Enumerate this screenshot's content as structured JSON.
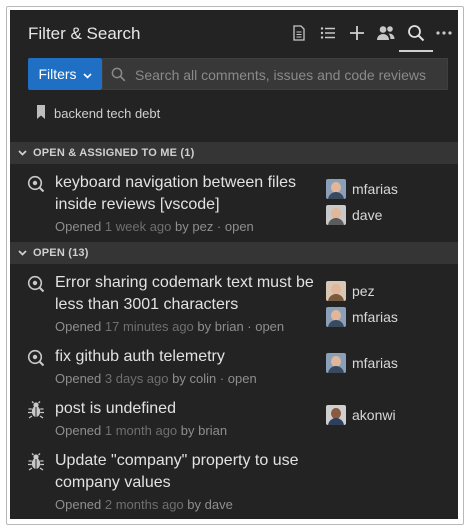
{
  "header": {
    "title": "Filter & Search",
    "tools": [
      "document-icon",
      "list-icon",
      "plus-icon",
      "people-icon",
      "search-icon",
      "more-icon"
    ]
  },
  "search": {
    "filters_label": "Filters",
    "placeholder": "Search all comments, issues and code reviews",
    "value": ""
  },
  "saved_filter": {
    "label": "backend tech debt",
    "icon": "bookmark-icon"
  },
  "sections": [
    {
      "label": "OPEN & ASSIGNED TO ME (1)",
      "items": [
        {
          "icon": "review-icon",
          "title_lines": [
            "keyboard navigation between files",
            "inside reviews [vscode]"
          ],
          "status_word": "Opened",
          "age": "1 week ago",
          "by": "by pez · open",
          "assignees": [
            "mfarias",
            "dave"
          ]
        }
      ]
    },
    {
      "label": "OPEN (13)",
      "items": [
        {
          "icon": "review-icon",
          "title_lines": [
            "Error sharing codemark text must be",
            "less than 3001 characters"
          ],
          "status_word": "Opened",
          "age": "17 minutes ago",
          "by": "by brian · open",
          "assignees": [
            "pez",
            "mfarias"
          ]
        },
        {
          "icon": "review-icon",
          "title_lines": [
            "fix github auth telemetry"
          ],
          "status_word": "Opened",
          "age": "3 days ago",
          "by": "by colin · open",
          "assignees": [
            "mfarias"
          ]
        },
        {
          "icon": "bug-icon",
          "title_lines": [
            "post is undefined"
          ],
          "status_word": "Opened",
          "age": "1 month ago",
          "by": "by brian",
          "assignees": [
            "akonwi"
          ]
        },
        {
          "icon": "bug-icon",
          "title_lines": [
            "Update \"company\" property to use",
            "company values"
          ],
          "status_word": "Opened",
          "age": "2 months ago",
          "by": "by dave",
          "assignees": []
        }
      ]
    }
  ],
  "colors": {
    "panel_bg": "#232323",
    "section_bg": "#353535",
    "accent": "#1f6fc5",
    "text": "#e2e2e2",
    "muted": "#8e8e8e"
  }
}
